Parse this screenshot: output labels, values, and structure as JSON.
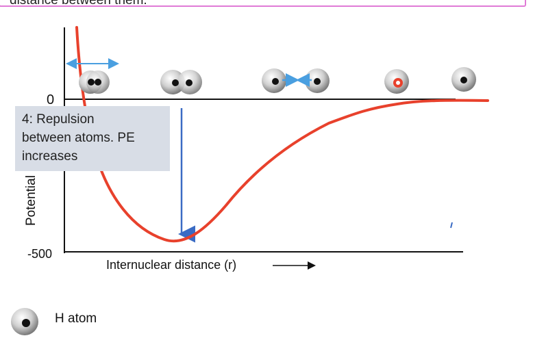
{
  "header": {
    "text": "distance between them."
  },
  "axis": {
    "y_tick_top": "0",
    "y_tick_bottom": "-500",
    "y_label": "Potential",
    "x_label": "Internuclear distance (r)"
  },
  "callout": {
    "line1": "4: Repulsion",
    "line2": "between atoms. PE",
    "line3": "increases"
  },
  "legend": {
    "label": "H atom",
    "icon": "h-atom-icon"
  },
  "colors": {
    "curve": "#e8412c",
    "arrow_blue": "#4a9fe0",
    "drop_line": "#3a6bc4",
    "callout_bg": "#d8dde6"
  }
}
